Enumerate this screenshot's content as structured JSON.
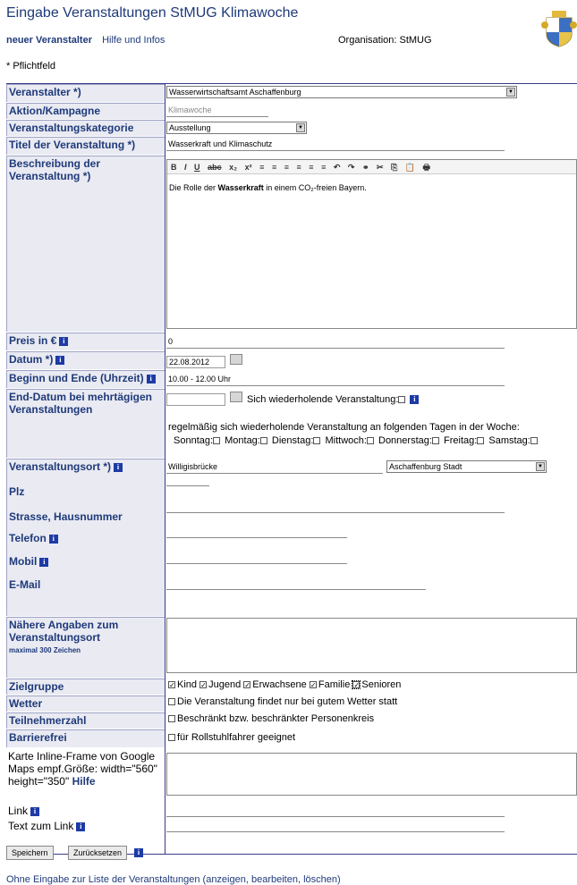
{
  "header": {
    "title": "Eingabe Veranstaltungen StMUG Klimawoche",
    "nav": {
      "new_organizer": "neuer Veranstalter",
      "help": "Hilfe und Infos"
    },
    "organisation": "Organisation: StMUG",
    "required_note": "* Pflichtfeld"
  },
  "labels": {
    "veranstalter": "Veranstalter *)",
    "aktion": "Aktion/Kampagne",
    "kategorie": "Veranstaltungskategorie",
    "titel": "Titel der Veranstaltung *)",
    "beschreibung": "Beschreibung der Veranstaltung *)",
    "preis": "Preis in €",
    "datum": "Datum *)",
    "zeit": "Beginn und Ende (Uhrzeit)",
    "enddatum": "End-Datum bei mehrtägigen Veranstaltungen",
    "ort": "Veranstaltungsort *)",
    "plz": "Plz",
    "strasse": "Strasse, Hausnummer",
    "telefon": "Telefon",
    "mobil": "Mobil",
    "email": "E-Mail",
    "naehere": "Nähere Angaben zum Veranstaltungsort",
    "naehere_hint": "maximal 300 Zeichen",
    "zielgruppe": "Zielgruppe",
    "wetter": "Wetter",
    "teilnehmer": "Teilnehmerzahl",
    "barriere": "Barrierefrei",
    "karte": "Karte Inline-Frame von Google Maps empf.Größe: width=\"560\" height=\"350\"",
    "karte_hilfe": "Hilfe",
    "link": "Link",
    "linktext": "Text zum Link"
  },
  "values": {
    "veranstalter": "Wasserwirtschaftsamt Aschaffenburg",
    "aktion": "Klimawoche",
    "kategorie": "Ausstellung",
    "titel": "Wasserkraft und Klimaschutz",
    "beschreibung_pre": "Die Rolle der ",
    "beschreibung_bold": "Wasserkraft",
    "beschreibung_post": " in einem CO₂-freien Bayern.",
    "preis": "0",
    "datum": "22.08.2012",
    "zeit": "10.00 - 12.00 Uhr",
    "ort": "Willigisbrücke",
    "ort_region": "Aschaffenburg Stadt"
  },
  "repeat": {
    "label": "Sich wiederholende Veranstaltung:",
    "weekly_text": "regelmäßig sich wiederholende Veranstaltung an folgenden Tagen in der Woche:",
    "days": [
      "Sonntag:",
      "Montag:",
      "Dienstag:",
      "Mittwoch:",
      "Donnerstag:",
      "Freitag:",
      "Samstag:"
    ]
  },
  "zielgruppe": [
    {
      "label": "Kind",
      "checked": true
    },
    {
      "label": "Jugend",
      "checked": true
    },
    {
      "label": "Erwachsene",
      "checked": true
    },
    {
      "label": "Familie",
      "checked": true
    },
    {
      "label": "Senioren",
      "checked": true
    }
  ],
  "options": {
    "wetter": "Die Veranstaltung findet nur bei gutem Wetter statt",
    "teilnehmer": "Beschränkt bzw. beschränkter Personenkreis",
    "barriere": "für Rollstuhlfahrer geeignet"
  },
  "editor_toolbar": [
    "B",
    "I",
    "U",
    "abc",
    "x₂",
    "x²",
    "≡",
    "≡",
    "≡",
    "≡",
    "≡",
    "≡",
    "↶",
    "↷",
    "⚭",
    "✂",
    "⎘",
    "📋",
    "🖶"
  ],
  "buttons": {
    "save": "Speichern",
    "reset": "Zurücksetzen"
  },
  "footer_link": "Ohne Eingabe zur Liste der Veranstaltungen (anzeigen, bearbeiten, löschen)",
  "info_glyph": "i"
}
